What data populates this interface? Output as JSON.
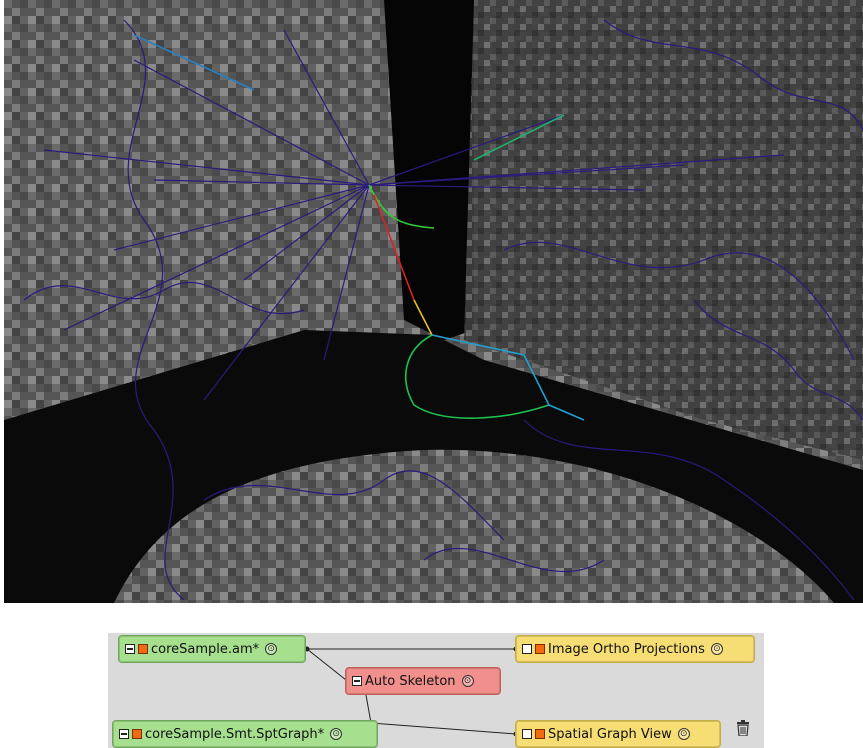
{
  "viewer": {
    "background": "#3a3a3a",
    "graph_color": "#2a1b7e"
  },
  "pool": {
    "nodes": {
      "core_sample": {
        "label": "coreSample.am*",
        "color": "#a6df8e"
      },
      "auto_skeleton": {
        "label": "Auto Skeleton",
        "color": "#f08f8b"
      },
      "ortho": {
        "label": "Image Ortho Projections",
        "color": "#f6de74"
      },
      "spt_graph": {
        "label": "coreSample.Smt.SptGraph*",
        "color": "#a6df8e"
      },
      "graph_view": {
        "label": "Spatial Graph View",
        "color": "#f6de74"
      }
    },
    "port_arrow": "⊙",
    "trash_icon": "trash-icon"
  }
}
